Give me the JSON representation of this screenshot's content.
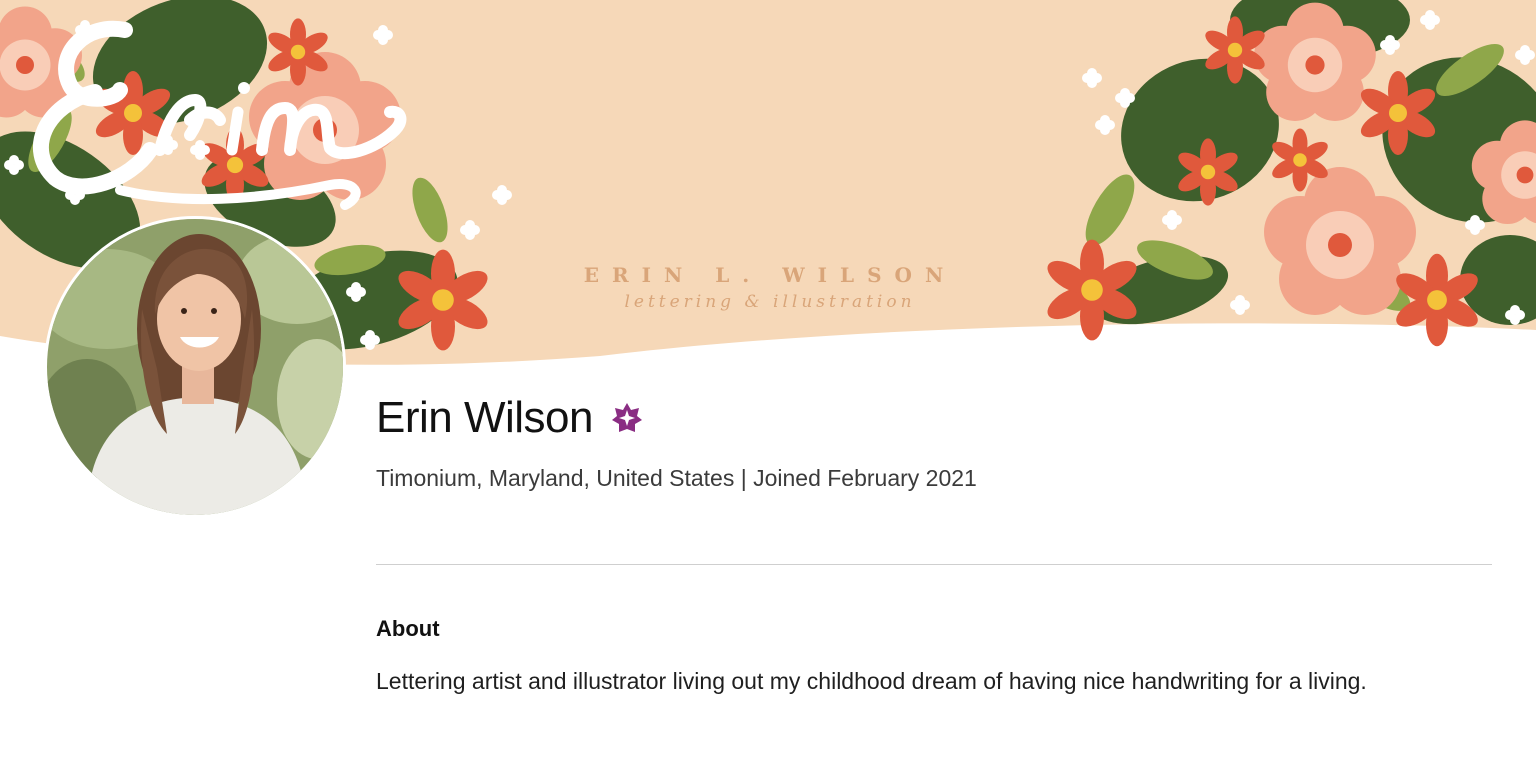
{
  "banner": {
    "brand_name": "ERIN L. WILSON",
    "tagline": "lettering & illustration",
    "script_lettering": "Erin",
    "colors": {
      "background": "#f6d8b8",
      "leaf_dark": "#3f5f2c",
      "leaf_light": "#8fa74a",
      "petal_pink": "#f2a48a",
      "petal_red": "#e0593c",
      "flower_center": "#f4c23a"
    }
  },
  "profile": {
    "name": "Erin Wilson",
    "meta": "Timonium, Maryland, United States | Joined February 2021",
    "badge_color": "#8a2d83",
    "badge_icon": "verified-star-icon"
  },
  "about": {
    "heading": "About",
    "text": "Lettering artist and illustrator living out my childhood dream of having nice handwriting for a living."
  }
}
